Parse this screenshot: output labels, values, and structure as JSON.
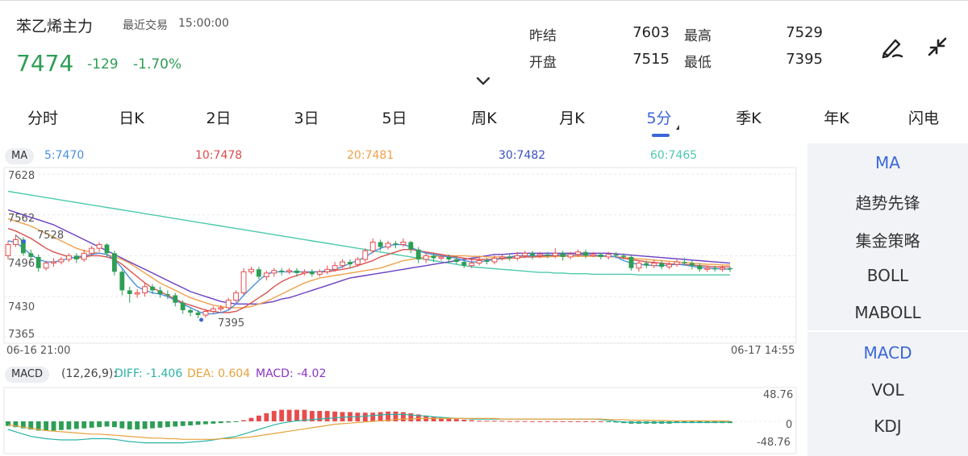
{
  "header": {
    "title": "苯乙烯主力",
    "time_label": "最近交易",
    "time_value": "15:00:00",
    "price": "7474",
    "change": "-129",
    "change_pct": "-1.70%",
    "stats": [
      {
        "label": "昨结",
        "value": "7603"
      },
      {
        "label": "最高",
        "value": "7529"
      },
      {
        "label": "开盘",
        "value": "7515"
      },
      {
        "label": "最低",
        "value": "7395"
      }
    ],
    "icons": [
      "draw-icon",
      "collapse-icon",
      "chevron-down-icon"
    ]
  },
  "tabs": [
    {
      "label": "分时"
    },
    {
      "label": "日K"
    },
    {
      "label": "2日"
    },
    {
      "label": "3日"
    },
    {
      "label": "5日"
    },
    {
      "label": "周K"
    },
    {
      "label": "月K"
    },
    {
      "label": "5分",
      "active": true
    },
    {
      "label": "季K"
    },
    {
      "label": "年K"
    },
    {
      "label": "闪电"
    }
  ],
  "ma_legend": {
    "pill": "MA",
    "items": [
      {
        "label": "5:7470",
        "color": "#4a8fe0"
      },
      {
        "label": "10:7478",
        "color": "#e04a4a"
      },
      {
        "label": "20:7481",
        "color": "#f0a04a"
      },
      {
        "label": "30:7482",
        "color": "#3a50c0"
      },
      {
        "label": "60:7465",
        "color": "#4ec9b0"
      }
    ]
  },
  "price_axis": {
    "ticks": [
      "7628",
      "7562",
      "7496",
      "7430",
      "7365"
    ],
    "high_mark": "7528",
    "low_mark": "7395"
  },
  "time_axis": {
    "start": "06-16 21:00",
    "end": "06-17 14:55"
  },
  "macd_legend": {
    "pill": "MACD",
    "params": "(12,26,9):",
    "diff": "DIFF: -1.406",
    "dea": "DEA: 0.604",
    "macd": "MACD: -4.02",
    "diff_color": "#2ab3a6",
    "dea_color": "#e6a23c",
    "macd_color": "#8a35c8"
  },
  "macd_axis": {
    "top": "48.76",
    "mid": "0",
    "bottom": "-48.76"
  },
  "side_panel": {
    "main_items": [
      {
        "label": "MA",
        "active": true
      },
      {
        "label": "趋势先锋"
      },
      {
        "label": "集金策略"
      },
      {
        "label": "BOLL"
      },
      {
        "label": "MABOLL"
      }
    ],
    "sub_items": [
      {
        "label": "MACD",
        "active": true
      },
      {
        "label": "VOL"
      },
      {
        "label": "KDJ"
      }
    ]
  },
  "colors": {
    "up": "#e74c4c",
    "down": "#2e9e55",
    "accent": "#3a66d8"
  },
  "candles": [
    [
      7496,
      7514,
      7520,
      7490
    ],
    [
      7514,
      7522,
      7530,
      7510
    ],
    [
      7522,
      7500,
      7526,
      7496
    ],
    [
      7500,
      7494,
      7506,
      7488
    ],
    [
      7494,
      7476,
      7498,
      7470
    ],
    [
      7476,
      7484,
      7488,
      7472
    ],
    [
      7484,
      7486,
      7492,
      7478
    ],
    [
      7486,
      7490,
      7494,
      7482
    ],
    [
      7490,
      7496,
      7500,
      7486
    ],
    [
      7496,
      7490,
      7500,
      7484
    ],
    [
      7490,
      7500,
      7506,
      7486
    ],
    [
      7500,
      7508,
      7512,
      7496
    ],
    [
      7508,
      7514,
      7518,
      7502
    ],
    [
      7514,
      7500,
      7516,
      7494
    ],
    [
      7500,
      7470,
      7504,
      7464
    ],
    [
      7470,
      7440,
      7474,
      7432
    ],
    [
      7440,
      7434,
      7446,
      7420
    ],
    [
      7434,
      7436,
      7442,
      7428
    ],
    [
      7436,
      7446,
      7452,
      7430
    ],
    [
      7446,
      7440,
      7450,
      7434
    ],
    [
      7440,
      7434,
      7446,
      7428
    ],
    [
      7434,
      7432,
      7440,
      7426
    ],
    [
      7432,
      7420,
      7436,
      7414
    ],
    [
      7420,
      7408,
      7424,
      7402
    ],
    [
      7408,
      7404,
      7412,
      7398
    ],
    [
      7404,
      7400,
      7408,
      7395
    ],
    [
      7400,
      7406,
      7410,
      7396
    ],
    [
      7406,
      7410,
      7414,
      7402
    ],
    [
      7410,
      7412,
      7416,
      7406
    ],
    [
      7412,
      7424,
      7428,
      7408
    ],
    [
      7424,
      7436,
      7440,
      7420
    ],
    [
      7436,
      7470,
      7476,
      7432
    ],
    [
      7470,
      7474,
      7478,
      7466
    ],
    [
      7474,
      7462,
      7478,
      7458
    ],
    [
      7462,
      7468,
      7472,
      7456
    ],
    [
      7468,
      7472,
      7476,
      7462
    ],
    [
      7472,
      7470,
      7476,
      7464
    ],
    [
      7470,
      7472,
      7476,
      7466
    ],
    [
      7472,
      7468,
      7476,
      7462
    ],
    [
      7468,
      7470,
      7474,
      7464
    ],
    [
      7470,
      7466,
      7474,
      7462
    ],
    [
      7466,
      7470,
      7474,
      7462
    ],
    [
      7470,
      7474,
      7480,
      7466
    ],
    [
      7474,
      7480,
      7486,
      7470
    ],
    [
      7480,
      7486,
      7490,
      7476
    ],
    [
      7486,
      7482,
      7490,
      7476
    ],
    [
      7482,
      7490,
      7494,
      7478
    ],
    [
      7490,
      7504,
      7508,
      7486
    ],
    [
      7504,
      7518,
      7524,
      7500
    ],
    [
      7518,
      7510,
      7522,
      7504
    ],
    [
      7510,
      7516,
      7520,
      7506
    ],
    [
      7516,
      7514,
      7520,
      7508
    ],
    [
      7514,
      7518,
      7524,
      7510
    ],
    [
      7518,
      7506,
      7520,
      7500
    ],
    [
      7506,
      7490,
      7510,
      7484
    ],
    [
      7490,
      7496,
      7500,
      7484
    ],
    [
      7496,
      7492,
      7500,
      7486
    ],
    [
      7492,
      7494,
      7498,
      7488
    ],
    [
      7494,
      7490,
      7498,
      7484
    ],
    [
      7490,
      7486,
      7496,
      7482
    ],
    [
      7486,
      7480,
      7490,
      7476
    ],
    [
      7480,
      7484,
      7490,
      7476
    ],
    [
      7484,
      7488,
      7494,
      7480
    ],
    [
      7488,
      7486,
      7492,
      7482
    ],
    [
      7486,
      7492,
      7496,
      7482
    ],
    [
      7492,
      7494,
      7498,
      7488
    ],
    [
      7494,
      7492,
      7500,
      7488
    ],
    [
      7492,
      7496,
      7502,
      7488
    ],
    [
      7496,
      7500,
      7504,
      7492
    ],
    [
      7500,
      7496,
      7504,
      7490
    ],
    [
      7496,
      7498,
      7502,
      7492
    ],
    [
      7498,
      7496,
      7502,
      7492
    ],
    [
      7496,
      7500,
      7508,
      7492
    ],
    [
      7500,
      7494,
      7504,
      7488
    ],
    [
      7494,
      7498,
      7502,
      7490
    ],
    [
      7498,
      7502,
      7506,
      7494
    ],
    [
      7502,
      7496,
      7506,
      7492
    ],
    [
      7496,
      7498,
      7502,
      7494
    ],
    [
      7498,
      7494,
      7500,
      7490
    ],
    [
      7494,
      7498,
      7502,
      7490
    ],
    [
      7498,
      7496,
      7502,
      7492
    ],
    [
      7496,
      7494,
      7500,
      7490
    ],
    [
      7494,
      7476,
      7498,
      7472
    ],
    [
      7476,
      7484,
      7488,
      7470
    ],
    [
      7484,
      7480,
      7488,
      7476
    ],
    [
      7480,
      7484,
      7490,
      7476
    ],
    [
      7484,
      7478,
      7488,
      7474
    ],
    [
      7478,
      7482,
      7486,
      7474
    ],
    [
      7482,
      7486,
      7490,
      7478
    ],
    [
      7486,
      7484,
      7492,
      7480
    ],
    [
      7484,
      7480,
      7488,
      7474
    ],
    [
      7480,
      7474,
      7484,
      7470
    ],
    [
      7474,
      7476,
      7480,
      7470
    ],
    [
      7476,
      7474,
      7480,
      7470
    ],
    [
      7474,
      7476,
      7480,
      7470
    ],
    [
      7476,
      7474,
      7478,
      7470
    ]
  ],
  "ma_lines": {
    "ma5": [
      7520,
      7518,
      7508,
      7498,
      7490,
      7486,
      7486,
      7488,
      7492,
      7494,
      7496,
      7498,
      7500,
      7498,
      7490,
      7476,
      7460,
      7446,
      7440,
      7436,
      7434,
      7430,
      7424,
      7418,
      7412,
      7406,
      7402,
      7402,
      7404,
      7408,
      7418,
      7432,
      7444,
      7456,
      7466,
      7470,
      7470,
      7470,
      7470,
      7470,
      7470,
      7470,
      7472,
      7474,
      7478,
      7484,
      7488,
      7494,
      7502,
      7508,
      7512,
      7514,
      7514,
      7510,
      7504,
      7500,
      7498,
      7496,
      7494,
      7492,
      7488,
      7486,
      7486,
      7488,
      7490,
      7492,
      7494,
      7496,
      7496,
      7496,
      7497,
      7497,
      7497,
      7498,
      7497,
      7498,
      7498,
      7497,
      7496,
      7496,
      7494,
      7488,
      7484,
      7482,
      7481,
      7480,
      7480,
      7481,
      7482,
      7481,
      7479,
      7477,
      7476,
      7475,
      7475,
      7474
    ],
    "ma10": [
      7540,
      7536,
      7530,
      7524,
      7516,
      7508,
      7502,
      7498,
      7494,
      7492,
      7494,
      7496,
      7496,
      7494,
      7490,
      7482,
      7472,
      7462,
      7452,
      7444,
      7438,
      7432,
      7426,
      7420,
      7416,
      7412,
      7408,
      7406,
      7404,
      7404,
      7406,
      7412,
      7420,
      7428,
      7436,
      7446,
      7454,
      7460,
      7464,
      7468,
      7470,
      7470,
      7470,
      7472,
      7474,
      7476,
      7480,
      7484,
      7488,
      7494,
      7498,
      7502,
      7506,
      7506,
      7504,
      7502,
      7500,
      7498,
      7496,
      7494,
      7492,
      7490,
      7490,
      7490,
      7490,
      7491,
      7492,
      7493,
      7494,
      7494,
      7495,
      7496,
      7496,
      7497,
      7497,
      7497,
      7497,
      7497,
      7496,
      7495,
      7494,
      7492,
      7490,
      7488,
      7486,
      7485,
      7484,
      7483,
      7482,
      7482,
      7481,
      7480,
      7479,
      7478,
      7478,
      7478
    ],
    "ma20": [
      7556,
      7552,
      7548,
      7544,
      7538,
      7532,
      7526,
      7520,
      7514,
      7508,
      7504,
      7502,
      7500,
      7498,
      7494,
      7490,
      7484,
      7476,
      7468,
      7460,
      7452,
      7446,
      7440,
      7434,
      7428,
      7424,
      7420,
      7416,
      7414,
      7412,
      7412,
      7412,
      7414,
      7418,
      7422,
      7428,
      7434,
      7440,
      7446,
      7452,
      7456,
      7460,
      7462,
      7464,
      7466,
      7468,
      7470,
      7472,
      7474,
      7476,
      7480,
      7484,
      7488,
      7490,
      7492,
      7494,
      7495,
      7496,
      7496,
      7496,
      7496,
      7495,
      7495,
      7494,
      7494,
      7494,
      7494,
      7494,
      7494,
      7494,
      7494,
      7494,
      7495,
      7495,
      7495,
      7495,
      7495,
      7495,
      7495,
      7495,
      7494,
      7493,
      7492,
      7491,
      7490,
      7489,
      7488,
      7487,
      7486,
      7485,
      7484,
      7483,
      7482,
      7482,
      7481,
      7481
    ],
    "ma30": [
      7570,
      7566,
      7562,
      7558,
      7554,
      7550,
      7546,
      7540,
      7534,
      7528,
      7522,
      7516,
      7510,
      7504,
      7498,
      7492,
      7486,
      7480,
      7474,
      7468,
      7462,
      7456,
      7450,
      7444,
      7438,
      7434,
      7430,
      7426,
      7422,
      7420,
      7418,
      7418,
      7418,
      7418,
      7420,
      7422,
      7426,
      7428,
      7432,
      7436,
      7440,
      7444,
      7448,
      7452,
      7456,
      7460,
      7462,
      7464,
      7466,
      7468,
      7470,
      7472,
      7474,
      7476,
      7478,
      7480,
      7482,
      7484,
      7486,
      7488,
      7490,
      7492,
      7494,
      7496,
      7498,
      7498,
      7499,
      7500,
      7500,
      7500,
      7500,
      7500,
      7500,
      7500,
      7500,
      7500,
      7500,
      7500,
      7500,
      7500,
      7499,
      7498,
      7497,
      7496,
      7495,
      7494,
      7493,
      7492,
      7491,
      7490,
      7489,
      7488,
      7487,
      7486,
      7485,
      7484
    ],
    "ma60": [
      7600,
      7598,
      7596,
      7594,
      7592,
      7590,
      7588,
      7586,
      7584,
      7582,
      7580,
      7578,
      7576,
      7574,
      7572,
      7570,
      7568,
      7566,
      7564,
      7562,
      7560,
      7558,
      7556,
      7554,
      7552,
      7550,
      7548,
      7546,
      7544,
      7542,
      7540,
      7538,
      7536,
      7534,
      7532,
      7530,
      7528,
      7526,
      7524,
      7522,
      7520,
      7518,
      7516,
      7514,
      7512,
      7510,
      7508,
      7506,
      7504,
      7502,
      7500,
      7498,
      7496,
      7494,
      7492,
      7490,
      7488,
      7486,
      7484,
      7482,
      7480,
      7478,
      7477,
      7476,
      7475,
      7474,
      7473,
      7472,
      7471,
      7470,
      7469,
      7469,
      7468,
      7468,
      7467,
      7467,
      7467,
      7466,
      7466,
      7466,
      7466,
      7466,
      7466,
      7465,
      7465,
      7465,
      7465,
      7465,
      7465,
      7465,
      7465,
      7465,
      7465,
      7465,
      7465,
      7465
    ]
  },
  "macd_series": {
    "hist": [
      -8,
      -10,
      -12,
      -14,
      -16,
      -16,
      -16,
      -15,
      -14,
      -13,
      -12,
      -11,
      -10,
      -9,
      -10,
      -12,
      -14,
      -14,
      -13,
      -12,
      -11,
      -10,
      -9,
      -8,
      -7,
      -6,
      -5,
      -4,
      -3,
      -2,
      -1,
      2,
      6,
      10,
      14,
      18,
      20,
      20,
      20,
      20,
      18,
      18,
      18,
      17,
      16,
      16,
      15,
      15,
      15,
      16,
      17,
      17,
      16,
      14,
      12,
      10,
      8,
      6,
      5,
      4,
      3,
      2,
      1,
      1,
      1,
      1,
      0.5,
      0.5,
      0.5,
      0.3,
      0.3,
      0.3,
      0.2,
      0.2,
      0.2,
      0.2,
      0.1,
      0.1,
      0.1,
      -0.5,
      -2,
      -3,
      -4,
      -4,
      -4,
      -4,
      -4,
      -4,
      -3,
      -3,
      -3,
      -3,
      -3,
      -3,
      -3,
      -3
    ],
    "diff": [
      -14,
      -18,
      -22,
      -26,
      -28,
      -30,
      -31,
      -32,
      -32,
      -32,
      -31,
      -30,
      -30,
      -30,
      -31,
      -33,
      -35,
      -36,
      -37,
      -37,
      -37,
      -37,
      -37,
      -37,
      -36,
      -35,
      -34,
      -32,
      -30,
      -28,
      -26,
      -22,
      -18,
      -14,
      -10,
      -6,
      -3,
      -1,
      1,
      2,
      3,
      4,
      5,
      6,
      7,
      8,
      8,
      9,
      10,
      11,
      12,
      12,
      12,
      11,
      10,
      9,
      8,
      7,
      6,
      5,
      5,
      4,
      4,
      4,
      4,
      4,
      4,
      4,
      4,
      4,
      4,
      4,
      4,
      4,
      4,
      4,
      4,
      4,
      3,
      2,
      0,
      -1,
      -2,
      -2,
      -2,
      -2,
      -2,
      -2,
      -2,
      -2,
      -2,
      -2,
      -2,
      -2,
      -1.5,
      -1.4
    ],
    "dea": [
      -6,
      -8,
      -10,
      -12,
      -14,
      -16,
      -17,
      -18,
      -19,
      -20,
      -21,
      -22,
      -22,
      -23,
      -24,
      -25,
      -26,
      -27,
      -28,
      -29,
      -29,
      -30,
      -30,
      -31,
      -31,
      -31,
      -31,
      -31,
      -30,
      -30,
      -29,
      -28,
      -27,
      -25,
      -23,
      -21,
      -19,
      -17,
      -15,
      -13,
      -11,
      -9,
      -7,
      -5,
      -4,
      -3,
      -2,
      -1,
      0,
      1,
      2,
      3,
      4,
      4,
      5,
      5,
      5,
      5,
      5,
      5,
      5,
      5,
      5,
      5,
      5,
      4,
      4,
      4,
      4,
      4,
      4,
      4,
      4,
      4,
      4,
      4,
      4,
      4,
      4,
      3,
      3,
      3,
      2,
      2,
      2,
      1.5,
      1.5,
      1,
      1,
      1,
      1,
      0.8,
      0.7,
      0.7,
      0.6,
      0.6
    ]
  }
}
